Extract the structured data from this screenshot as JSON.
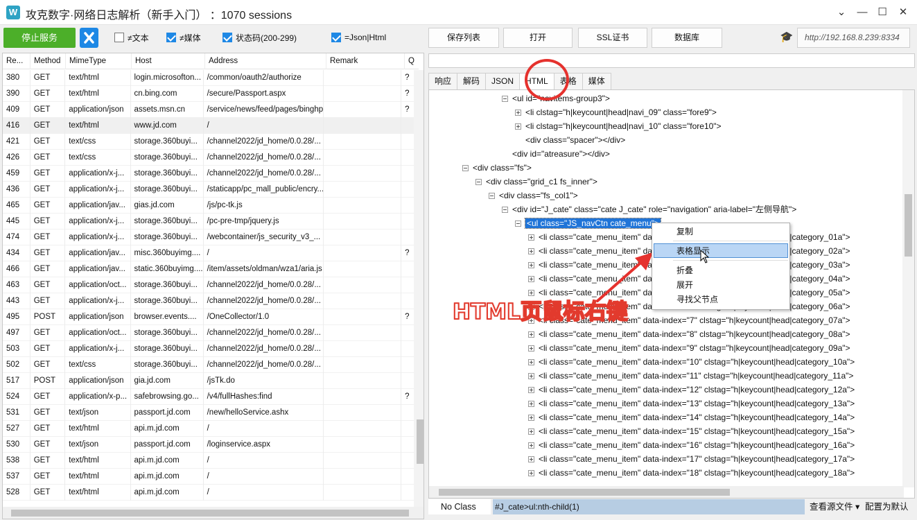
{
  "window": {
    "title": "攻克数字·网络日志解析（新手入门）  ：1070 sessions",
    "app_icon_letter": "W"
  },
  "toolbar": {
    "stop_label": "停止服务",
    "check_text": "≠文本",
    "check_media": "≠媒体",
    "check_status": "状态码(200-299)",
    "check_json": "=Json|Html",
    "save_list": "保存列表",
    "open": "打开",
    "ssl": "SSL证书",
    "database": "数据库",
    "url": "http://192.168.8.239:8334"
  },
  "table": {
    "headers": [
      "Re...",
      "Method",
      "MimeType",
      "Host",
      "Address",
      "Remark",
      "Q"
    ],
    "rows": [
      [
        "380",
        "GET",
        "text/html",
        "login.microsofton...",
        "/common/oauth2/authorize",
        "",
        "?"
      ],
      [
        "390",
        "GET",
        "text/html",
        "cn.bing.com",
        "/secure/Passport.aspx",
        "",
        "?"
      ],
      [
        "409",
        "GET",
        "application/json",
        "assets.msn.cn",
        "/service/news/feed/pages/binghp",
        "",
        "?"
      ],
      [
        "416",
        "GET",
        "text/html",
        "www.jd.com",
        "/",
        "",
        ""
      ],
      [
        "421",
        "GET",
        "text/css",
        "storage.360buyi...",
        "/channel2022/jd_home/0.0.28/...",
        "",
        ""
      ],
      [
        "426",
        "GET",
        "text/css",
        "storage.360buyi...",
        "/channel2022/jd_home/0.0.28/...",
        "",
        ""
      ],
      [
        "459",
        "GET",
        "application/x-j...",
        "storage.360buyi...",
        "/channel2022/jd_home/0.0.28/...",
        "",
        ""
      ],
      [
        "436",
        "GET",
        "application/x-j...",
        "storage.360buyi...",
        "/staticapp/pc_mall_public/encry...",
        "",
        ""
      ],
      [
        "465",
        "GET",
        "application/jav...",
        "gias.jd.com",
        "/js/pc-tk.js",
        "",
        ""
      ],
      [
        "445",
        "GET",
        "application/x-j...",
        "storage.360buyi...",
        "/pc-pre-tmp/jquery.js",
        "",
        ""
      ],
      [
        "474",
        "GET",
        "application/x-j...",
        "storage.360buyi...",
        "/webcontainer/js_security_v3_...",
        "",
        ""
      ],
      [
        "434",
        "GET",
        "application/jav...",
        "misc.360buyimg....",
        "/",
        "",
        "?"
      ],
      [
        "466",
        "GET",
        "application/jav...",
        "static.360buyimg....",
        "/item/assets/oldman/wza1/aria.js",
        "",
        ""
      ],
      [
        "463",
        "GET",
        "application/oct...",
        "storage.360buyi...",
        "/channel2022/jd_home/0.0.28/...",
        "",
        ""
      ],
      [
        "443",
        "GET",
        "application/x-j...",
        "storage.360buyi...",
        "/channel2022/jd_home/0.0.28/...",
        "",
        ""
      ],
      [
        "495",
        "POST",
        "application/json",
        "browser.events....",
        "/OneCollector/1.0",
        "",
        "?"
      ],
      [
        "497",
        "GET",
        "application/oct...",
        "storage.360buyi...",
        "/channel2022/jd_home/0.0.28/...",
        "",
        ""
      ],
      [
        "503",
        "GET",
        "application/x-j...",
        "storage.360buyi...",
        "/channel2022/jd_home/0.0.28/...",
        "",
        ""
      ],
      [
        "502",
        "GET",
        "text/css",
        "storage.360buyi...",
        "/channel2022/jd_home/0.0.28/...",
        "",
        ""
      ],
      [
        "517",
        "POST",
        "application/json",
        "gia.jd.com",
        "/jsTk.do",
        "",
        ""
      ],
      [
        "524",
        "GET",
        "application/x-p...",
        "safebrowsing.go...",
        "/v4/fullHashes:find",
        "",
        "?"
      ],
      [
        "531",
        "GET",
        "text/json",
        "passport.jd.com",
        "/new/helloService.ashx",
        "",
        ""
      ],
      [
        "527",
        "GET",
        "text/html",
        "api.m.jd.com",
        "/",
        "",
        ""
      ],
      [
        "530",
        "GET",
        "text/json",
        "passport.jd.com",
        "/loginservice.aspx",
        "",
        ""
      ],
      [
        "538",
        "GET",
        "text/html",
        "api.m.jd.com",
        "/",
        "",
        ""
      ],
      [
        "537",
        "GET",
        "text/html",
        "api.m.jd.com",
        "/",
        "",
        ""
      ],
      [
        "528",
        "GET",
        "text/html",
        "api.m.jd.com",
        "/",
        "",
        ""
      ]
    ]
  },
  "tabs": [
    "响应",
    "解码",
    "JSON",
    "HTML",
    "表格",
    "媒体"
  ],
  "tree": [
    {
      "indent": 5,
      "exp": "minus",
      "text": "<ul id=\"navitems-group3\">"
    },
    {
      "indent": 6,
      "exp": "plus",
      "text": "<li clstag=\"h|keycount|head|navi_09\" class=\"fore9\">"
    },
    {
      "indent": 6,
      "exp": "plus",
      "text": "<li clstag=\"h|keycount|head|navi_10\" class=\"fore10\">"
    },
    {
      "indent": 6,
      "exp": "none",
      "text": "<div class=\"spacer\"></div>"
    },
    {
      "indent": 5,
      "exp": "none",
      "text": "<div id=\"atreasure\"></div>"
    },
    {
      "indent": 2,
      "exp": "minus",
      "text": "<div class=\"fs\">"
    },
    {
      "indent": 3,
      "exp": "minus",
      "text": "<div class=\"grid_c1 fs_inner\">"
    },
    {
      "indent": 4,
      "exp": "minus",
      "text": "<div class=\"fs_col1\">"
    },
    {
      "indent": 5,
      "exp": "minus",
      "text": "<div id=\"J_cate\" class=\"cate J_cate\" role=\"navigation\" aria-label=\"左侧导航\">"
    },
    {
      "indent": 6,
      "exp": "minus",
      "text": "<ul class=\"JS_navCtn cate_menu\">",
      "hl": true
    },
    {
      "indent": 7,
      "exp": "plus",
      "text": "<li class=\"cate_menu_item\" data-index=\"1\" clstag=\"h|keycount|head|category_01a\">"
    },
    {
      "indent": 7,
      "exp": "plus",
      "text": "<li class=\"cate_menu_item\" data-index=\"2\" clstag=\"h|keycount|head|category_02a\">"
    },
    {
      "indent": 7,
      "exp": "plus",
      "text": "<li class=\"cate_menu_item\" data-index=\"3\" clstag=\"h|keycount|head|category_03a\">"
    },
    {
      "indent": 7,
      "exp": "plus",
      "text": "<li class=\"cate_menu_item\" data-index=\"4\" clstag=\"h|keycount|head|category_04a\">"
    },
    {
      "indent": 7,
      "exp": "plus",
      "text": "<li class=\"cate_menu_item\" data-index=\"5\" clstag=\"h|keycount|head|category_05a\">"
    },
    {
      "indent": 7,
      "exp": "plus",
      "text": "<li class=\"cate_menu_item\" data-index=\"6\" clstag=\"h|keycount|head|category_06a\">"
    },
    {
      "indent": 7,
      "exp": "plus",
      "text": "<li class=\"cate_menu_item\" data-index=\"7\" clstag=\"h|keycount|head|category_07a\">"
    },
    {
      "indent": 7,
      "exp": "plus",
      "text": "<li class=\"cate_menu_item\" data-index=\"8\" clstag=\"h|keycount|head|category_08a\">"
    },
    {
      "indent": 7,
      "exp": "plus",
      "text": "<li class=\"cate_menu_item\" data-index=\"9\" clstag=\"h|keycount|head|category_09a\">"
    },
    {
      "indent": 7,
      "exp": "plus",
      "text": "<li class=\"cate_menu_item\" data-index=\"10\" clstag=\"h|keycount|head|category_10a\">"
    },
    {
      "indent": 7,
      "exp": "plus",
      "text": "<li class=\"cate_menu_item\" data-index=\"11\" clstag=\"h|keycount|head|category_11a\">"
    },
    {
      "indent": 7,
      "exp": "plus",
      "text": "<li class=\"cate_menu_item\" data-index=\"12\" clstag=\"h|keycount|head|category_12a\">"
    },
    {
      "indent": 7,
      "exp": "plus",
      "text": "<li class=\"cate_menu_item\" data-index=\"13\" clstag=\"h|keycount|head|category_13a\">"
    },
    {
      "indent": 7,
      "exp": "plus",
      "text": "<li class=\"cate_menu_item\" data-index=\"14\" clstag=\"h|keycount|head|category_14a\">"
    },
    {
      "indent": 7,
      "exp": "plus",
      "text": "<li class=\"cate_menu_item\" data-index=\"15\" clstag=\"h|keycount|head|category_15a\">"
    },
    {
      "indent": 7,
      "exp": "plus",
      "text": "<li class=\"cate_menu_item\" data-index=\"16\" clstag=\"h|keycount|head|category_16a\">"
    },
    {
      "indent": 7,
      "exp": "plus",
      "text": "<li class=\"cate_menu_item\" data-index=\"17\" clstag=\"h|keycount|head|category_17a\">"
    },
    {
      "indent": 7,
      "exp": "plus",
      "text": "<li class=\"cate_menu_item\" data-index=\"18\" clstag=\"h|keycount|head|category_18a\">"
    }
  ],
  "context_menu": [
    "复制",
    "表格显示",
    "折叠",
    "展开",
    "寻找父节点"
  ],
  "annotation": "HTML页鼠标右键",
  "bottom": {
    "class_filter": "No Class",
    "selector": "#J_cate>ul:nth-child(1)",
    "view_source": "查看源文件 ▾",
    "set_default": "配置为默认"
  },
  "colors": {
    "accent": "#1e88e5",
    "stop": "#4caf29",
    "highlight": "#1f74d8",
    "annotation": "#e23a2d"
  }
}
